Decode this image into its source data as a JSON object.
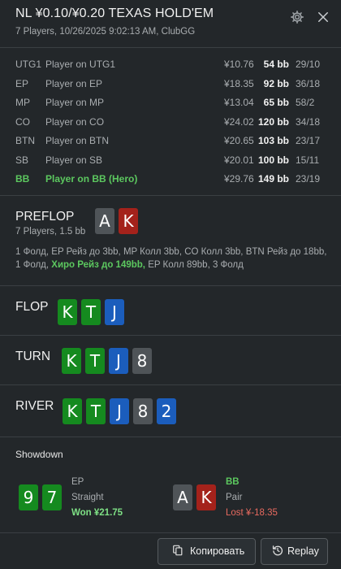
{
  "header": {
    "title": "NL ¥0.10/¥0.20 TEXAS HOLD'EM",
    "subtitle": "7 Players, 10/26/2025 9:02:13 AM, ClubGG"
  },
  "players": [
    {
      "pos": "UTG1",
      "name": "Player on UTG1",
      "money": "¥10.76",
      "bb": "54 bb",
      "stat": "29/10"
    },
    {
      "pos": "EP",
      "name": "Player on EP",
      "money": "¥18.35",
      "bb": "92 bb",
      "stat": "36/18"
    },
    {
      "pos": "MP",
      "name": "Player on MP",
      "money": "¥13.04",
      "bb": "65 bb",
      "stat": "58/2"
    },
    {
      "pos": "CO",
      "name": "Player on CO",
      "money": "¥24.02",
      "bb": "120 bb",
      "stat": "34/18"
    },
    {
      "pos": "BTN",
      "name": "Player on BTN",
      "money": "¥20.65",
      "bb": "103 bb",
      "stat": "23/17"
    },
    {
      "pos": "SB",
      "name": "Player on SB",
      "money": "¥20.01",
      "bb": "100 bb",
      "stat": "15/11"
    },
    {
      "pos": "BB",
      "name": "Player on BB (Hero)",
      "money": "¥29.76",
      "bb": "149 bb",
      "stat": "23/19"
    }
  ],
  "preflop": {
    "title": "PREFLOP",
    "info": "7 Players, 1.5 bb",
    "cards": [
      "A",
      "K"
    ],
    "action_line1": "1 Фолд, EP Рейз до 3bb, MP Колл 3bb, CO Колл 3bb, BTN Рейз до 18bb,",
    "action_line2_pre": "1 Фолд, ",
    "action_hero": "Хиро Рейз до 149bb,",
    "action_line2_post": " EP Колл 89bb, 3 Фолд"
  },
  "flop": {
    "title": "FLOP",
    "cards": [
      "K",
      "T",
      "J"
    ]
  },
  "turn": {
    "title": "TURN",
    "cards": [
      "K",
      "T",
      "J",
      "8"
    ]
  },
  "river": {
    "title": "RIVER",
    "cards": [
      "K",
      "T",
      "J",
      "8",
      "2"
    ]
  },
  "showdown": {
    "title": "Showdown",
    "left": {
      "cards": [
        "9",
        "7"
      ],
      "pos": "EP",
      "hand": "Straight",
      "result": "Won ¥21.75"
    },
    "right": {
      "cards": [
        "A",
        "K"
      ],
      "pos": "BB",
      "hand": "Pair",
      "result": "Lost ¥-18.35"
    }
  },
  "footer": {
    "copy_label": "Копировать",
    "replay_label": "Replay"
  },
  "colors": {
    "background": "#23272a",
    "hero_green": "#5cc85f",
    "won_green": "#7ee085",
    "lost_red": "#e86a5f",
    "card_gray": "#4f5458",
    "card_red": "#a4221b",
    "card_green": "#158a1f",
    "card_blue": "#1b5dbc"
  },
  "icons": {
    "settings": "gear-icon",
    "close": "close-icon",
    "copy": "copy-icon",
    "replay": "replay-icon"
  }
}
